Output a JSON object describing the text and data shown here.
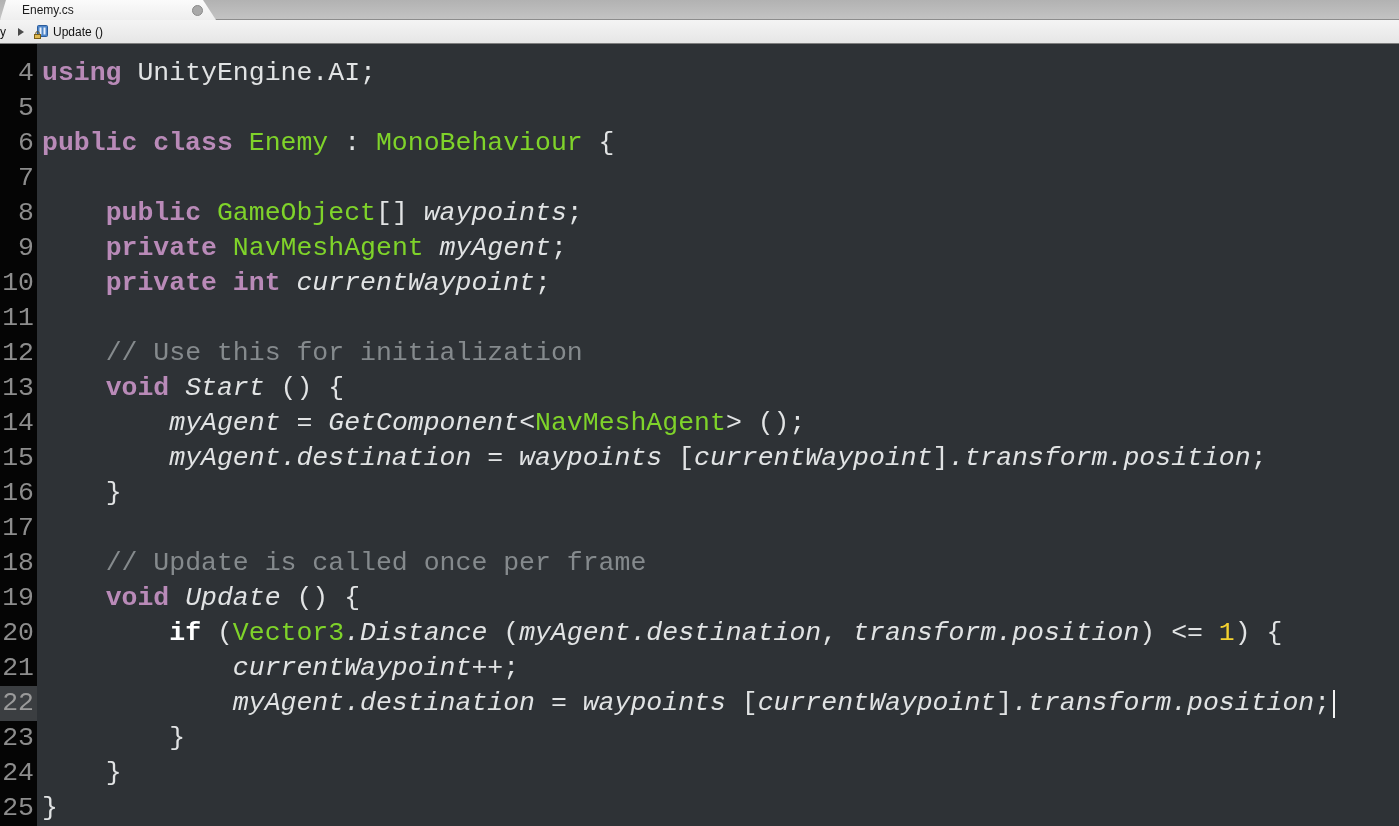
{
  "tabs": [
    {
      "title": "Enemy.cs",
      "selected": true,
      "modified": true
    }
  ],
  "breadcrumb": [
    {
      "label": "y",
      "kind": "plain"
    },
    {
      "label": "Update ()",
      "kind": "method"
    }
  ],
  "lines": [
    {
      "number": "4",
      "current": false,
      "tokens": [
        {
          "kind": "keyword",
          "text": "using"
        },
        {
          "kind": "plain",
          "text": " UnityEngine.AI;"
        }
      ]
    },
    {
      "number": "5",
      "current": false
    },
    {
      "number": "6",
      "current": false,
      "tokens": [
        {
          "kind": "keyword",
          "text": "public class "
        },
        {
          "kind": "type",
          "text": "Enemy"
        },
        {
          "kind": "plain",
          "text": " : "
        },
        {
          "kind": "type",
          "text": "MonoBehaviour"
        },
        {
          "kind": "plain",
          "text": " {"
        }
      ]
    },
    {
      "number": "7",
      "current": false
    },
    {
      "number": "8",
      "current": false,
      "tokens": [
        {
          "kind": "keyword",
          "text": "    public "
        },
        {
          "kind": "type",
          "text": "GameObject"
        },
        {
          "kind": "plain",
          "text": "[] "
        },
        {
          "kind": "ident",
          "text": "waypoints"
        },
        {
          "kind": "plain",
          "text": ";"
        }
      ]
    },
    {
      "number": "9",
      "current": false,
      "tokens": [
        {
          "kind": "keyword",
          "text": "    private "
        },
        {
          "kind": "type",
          "text": "NavMeshAgent"
        },
        {
          "kind": "ident",
          "text": " myAgent"
        },
        {
          "kind": "plain",
          "text": ";"
        }
      ]
    },
    {
      "number": "10",
      "current": false,
      "tokens": [
        {
          "kind": "keyword",
          "text": "    private int "
        },
        {
          "kind": "ident",
          "text": "currentWaypoint"
        },
        {
          "kind": "plain",
          "text": ";"
        }
      ]
    },
    {
      "number": "11",
      "current": false
    },
    {
      "number": "12",
      "current": false,
      "tokens": [
        {
          "kind": "comment",
          "text": "    // Use this for initialization"
        }
      ]
    },
    {
      "number": "13",
      "current": false,
      "tokens": [
        {
          "kind": "keyword",
          "text": "    void "
        },
        {
          "kind": "ident",
          "text": "Start"
        },
        {
          "kind": "plain",
          "text": " () {"
        }
      ]
    },
    {
      "number": "14",
      "current": false,
      "tokens": [
        {
          "kind": "ident",
          "text": "        myAgent"
        },
        {
          "kind": "plain",
          "text": " = "
        },
        {
          "kind": "ident",
          "text": "GetComponent"
        },
        {
          "kind": "plain",
          "text": "<"
        },
        {
          "kind": "type",
          "text": "NavMeshAgent"
        },
        {
          "kind": "plain",
          "text": "> ();"
        }
      ]
    },
    {
      "number": "15",
      "current": false,
      "tokens": [
        {
          "kind": "ident",
          "text": "        myAgent.destination"
        },
        {
          "kind": "plain",
          "text": " = "
        },
        {
          "kind": "ident",
          "text": "waypoints"
        },
        {
          "kind": "plain",
          "text": " ["
        },
        {
          "kind": "ident",
          "text": "currentWaypoint"
        },
        {
          "kind": "plain",
          "text": "]"
        },
        {
          "kind": "ident",
          "text": ".transform.position"
        },
        {
          "kind": "plain",
          "text": ";"
        }
      ]
    },
    {
      "number": "16",
      "current": false,
      "tokens": [
        {
          "kind": "plain",
          "text": "    }"
        }
      ]
    },
    {
      "number": "17",
      "current": false
    },
    {
      "number": "18",
      "current": false,
      "tokens": [
        {
          "kind": "comment",
          "text": "    // Update is called once per frame"
        }
      ]
    },
    {
      "number": "19",
      "current": false,
      "tokens": [
        {
          "kind": "keyword",
          "text": "    void "
        },
        {
          "kind": "ident",
          "text": "Update"
        },
        {
          "kind": "plain",
          "text": " () {"
        }
      ]
    },
    {
      "number": "20",
      "current": false,
      "tokens": [
        {
          "kind": "control",
          "text": "        if"
        },
        {
          "kind": "plain",
          "text": " ("
        },
        {
          "kind": "type",
          "text": "Vector3"
        },
        {
          "kind": "ident",
          "text": ".Distance"
        },
        {
          "kind": "plain",
          "text": " ("
        },
        {
          "kind": "ident",
          "text": "myAgent.destination"
        },
        {
          "kind": "plain",
          "text": ", "
        },
        {
          "kind": "ident",
          "text": "transform.position"
        },
        {
          "kind": "plain",
          "text": ") <= "
        },
        {
          "kind": "number",
          "text": "1"
        },
        {
          "kind": "plain",
          "text": ") {"
        }
      ]
    },
    {
      "number": "21",
      "current": false,
      "tokens": [
        {
          "kind": "ident",
          "text": "            currentWaypoint"
        },
        {
          "kind": "plain",
          "text": "++;"
        }
      ]
    },
    {
      "number": "22",
      "current": true,
      "tokens": [
        {
          "kind": "ident",
          "text": "            myAgent.destination"
        },
        {
          "kind": "plain",
          "text": " = "
        },
        {
          "kind": "ident",
          "text": "waypoints"
        },
        {
          "kind": "plain",
          "text": " ["
        },
        {
          "kind": "ident",
          "text": "currentWaypoint"
        },
        {
          "kind": "plain",
          "text": "]"
        },
        {
          "kind": "ident",
          "text": ".transform.position"
        },
        {
          "kind": "plain",
          "text": ";"
        }
      ]
    },
    {
      "number": "23",
      "current": false,
      "tokens": [
        {
          "kind": "plain",
          "text": "        }"
        }
      ]
    },
    {
      "number": "24",
      "current": false,
      "tokens": [
        {
          "kind": "plain",
          "text": "    }"
        }
      ]
    },
    {
      "number": "25",
      "current": false,
      "tokens": [
        {
          "kind": "plain",
          "text": "}"
        }
      ]
    }
  ]
}
